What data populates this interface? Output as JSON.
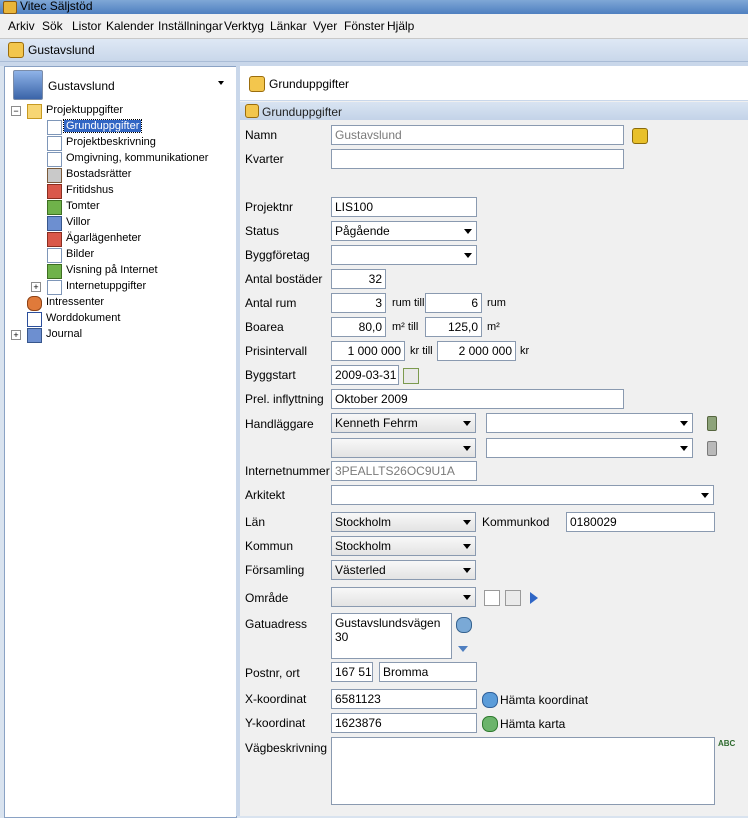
{
  "window": {
    "title": "Vitec Säljstöd"
  },
  "menu": [
    {
      "label": "Arkiv"
    },
    {
      "label": "Sök"
    },
    {
      "label": "Listor"
    },
    {
      "label": "Kalender"
    },
    {
      "label": "Inställningar"
    },
    {
      "label": "Verktyg"
    },
    {
      "label": "Länkar"
    },
    {
      "label": "Vyer"
    },
    {
      "label": "Fönster"
    },
    {
      "label": "Hjälp"
    }
  ],
  "document_tab": {
    "label": "Gustavslund"
  },
  "project_selector": {
    "value": "Gustavslund"
  },
  "tree": [
    {
      "label": "Projektuppgifter"
    },
    {
      "label": "Grunduppgifter"
    },
    {
      "label": "Projektbeskrivning"
    },
    {
      "label": "Omgivning, kommunikationer"
    },
    {
      "label": "Bostadsrätter"
    },
    {
      "label": "Fritidshus"
    },
    {
      "label": "Tomter"
    },
    {
      "label": "Villor"
    },
    {
      "label": "Ägarlägenheter"
    },
    {
      "label": "Bilder"
    },
    {
      "label": "Visning på Internet"
    },
    {
      "label": "Internetuppgifter"
    },
    {
      "label": "Intressenter"
    },
    {
      "label": "Worddokument"
    },
    {
      "label": "Journal"
    }
  ],
  "panel": {
    "title": "Grunduppgifter",
    "section": "Grunduppgifter"
  },
  "form": {
    "namn": {
      "label": "Namn",
      "value": "Gustavslund"
    },
    "kvarter": {
      "label": "Kvarter",
      "value": ""
    },
    "projektnr": {
      "label": "Projektnr",
      "value": "LIS100"
    },
    "status": {
      "label": "Status",
      "value": "Pågående"
    },
    "byggforetag": {
      "label": "Byggföretag",
      "value": ""
    },
    "antal_bostader": {
      "label": "Antal bostäder",
      "value": "32"
    },
    "antal_rum": {
      "label": "Antal rum",
      "from": "3",
      "mid": "rum till",
      "to": "6",
      "unit": "rum"
    },
    "boarea": {
      "label": "Boarea",
      "from": "80,0",
      "mid": "m² till",
      "to": "125,0",
      "unit": "m²"
    },
    "prisintervall": {
      "label": "Prisintervall",
      "from": "1 000 000",
      "mid": "kr till",
      "to": "2 000 000",
      "unit": "kr"
    },
    "byggstart": {
      "label": "Byggstart",
      "value": "2009-03-31"
    },
    "inflyttning": {
      "label": "Prel. inflyttning",
      "value": "Oktober 2009"
    },
    "handlaggare": {
      "label": "Handläggare",
      "value1": "Kenneth Fehrm",
      "value1b": "",
      "value2": "",
      "value2b": ""
    },
    "internetnummer": {
      "label": "Internetnummer",
      "value": "3PEALLTS26OC9U1A"
    },
    "arkitekt": {
      "label": "Arkitekt",
      "value": ""
    },
    "lan": {
      "label": "Län",
      "value": "Stockholm"
    },
    "kommunkod": {
      "label": "Kommunkod",
      "value": "0180029"
    },
    "kommun": {
      "label": "Kommun",
      "value": "Stockholm"
    },
    "forsamling": {
      "label": "Församling",
      "value": "Västerled"
    },
    "omrade": {
      "label": "Område",
      "value": ""
    },
    "gatuadress": {
      "label": "Gatuadress",
      "value": "Gustavslundsvägen 30"
    },
    "postnr": {
      "label": "Postnr, ort",
      "postnr": "167 51",
      "ort": "Bromma"
    },
    "xkoord": {
      "label": "X-koordinat",
      "value": "6581123",
      "action": "Hämta koordinat"
    },
    "ykoord": {
      "label": "Y-koordinat",
      "value": "1623876",
      "action": "Hämta karta"
    },
    "vagbeskrivning": {
      "label": "Vägbeskrivning",
      "value": ""
    }
  }
}
